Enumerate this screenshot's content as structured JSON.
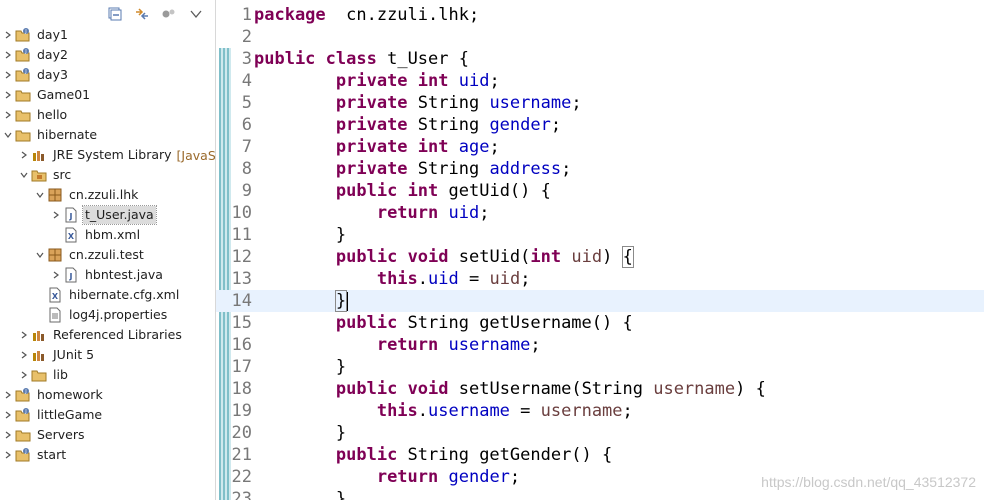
{
  "explorer": {
    "items": [
      {
        "label": "day1",
        "indent": 0,
        "expanded": false,
        "icon": "project-icon"
      },
      {
        "label": "day2",
        "indent": 0,
        "expanded": false,
        "icon": "project-icon"
      },
      {
        "label": "day3",
        "indent": 0,
        "expanded": false,
        "icon": "project-icon"
      },
      {
        "label": "Game01",
        "indent": 0,
        "expanded": false,
        "icon": "folder-icon"
      },
      {
        "label": "hello",
        "indent": 0,
        "expanded": false,
        "icon": "folder-icon"
      },
      {
        "label": "hibernate",
        "indent": 0,
        "expanded": true,
        "icon": "folder-icon"
      },
      {
        "label": "JRE System Library",
        "decoration": "[JavaSE-",
        "indent": 1,
        "expanded": false,
        "icon": "library-icon"
      },
      {
        "label": "src",
        "indent": 1,
        "expanded": true,
        "icon": "source-folder-icon"
      },
      {
        "label": "cn.zzuli.lhk",
        "indent": 2,
        "expanded": true,
        "icon": "package-icon"
      },
      {
        "label": "t_User.java",
        "indent": 3,
        "expanded": false,
        "icon": "java-file-icon",
        "selected": true
      },
      {
        "label": "hbm.xml",
        "indent": 3,
        "leaf": true,
        "icon": "xml-file-icon"
      },
      {
        "label": "cn.zzuli.test",
        "indent": 2,
        "expanded": true,
        "icon": "package-icon"
      },
      {
        "label": "hbntest.java",
        "indent": 3,
        "expanded": false,
        "icon": "java-file-icon"
      },
      {
        "label": "hibernate.cfg.xml",
        "indent": 2,
        "leaf": true,
        "icon": "xml-file-icon"
      },
      {
        "label": "log4j.properties",
        "indent": 2,
        "leaf": true,
        "icon": "properties-file-icon"
      },
      {
        "label": "Referenced Libraries",
        "indent": 1,
        "expanded": false,
        "icon": "library-icon"
      },
      {
        "label": "JUnit 5",
        "indent": 1,
        "expanded": false,
        "icon": "library-icon"
      },
      {
        "label": "lib",
        "indent": 1,
        "expanded": false,
        "icon": "folder-icon"
      },
      {
        "label": "homework",
        "indent": 0,
        "expanded": false,
        "icon": "project-icon"
      },
      {
        "label": "littleGame",
        "indent": 0,
        "expanded": false,
        "icon": "project-icon"
      },
      {
        "label": "Servers",
        "indent": 0,
        "expanded": false,
        "icon": "folder-icon"
      },
      {
        "label": "start",
        "indent": 0,
        "expanded": false,
        "icon": "project-icon"
      }
    ],
    "toolbar": [
      "collapse-all-icon",
      "link-with-editor-icon",
      "filters-icon",
      "view-menu-icon"
    ]
  },
  "editor": {
    "current_line": 14,
    "lines": [
      {
        "n": "1",
        "t": [
          [
            "kw",
            "package"
          ],
          [
            "",
            "  cn.zzuli.lhk;"
          ]
        ]
      },
      {
        "n": "2",
        "t": []
      },
      {
        "n": "3",
        "t": [
          [
            "kw",
            "public"
          ],
          [
            "",
            " "
          ],
          [
            "kw",
            "class"
          ],
          [
            "",
            " t_User {"
          ]
        ]
      },
      {
        "n": "4",
        "t": [
          [
            "",
            "        "
          ],
          [
            "kw",
            "private"
          ],
          [
            "",
            " "
          ],
          [
            "kw",
            "int"
          ],
          [
            "",
            " "
          ],
          [
            "fld",
            "uid"
          ],
          [
            "",
            ";"
          ]
        ]
      },
      {
        "n": "5",
        "t": [
          [
            "",
            "        "
          ],
          [
            "kw",
            "private"
          ],
          [
            "",
            " String "
          ],
          [
            "fld",
            "username"
          ],
          [
            "",
            ";"
          ]
        ]
      },
      {
        "n": "6",
        "t": [
          [
            "",
            "        "
          ],
          [
            "kw",
            "private"
          ],
          [
            "",
            " String "
          ],
          [
            "fld",
            "gender"
          ],
          [
            "",
            ";"
          ]
        ]
      },
      {
        "n": "7",
        "t": [
          [
            "",
            "        "
          ],
          [
            "kw",
            "private"
          ],
          [
            "",
            " "
          ],
          [
            "kw",
            "int"
          ],
          [
            "",
            " "
          ],
          [
            "fld",
            "age"
          ],
          [
            "",
            ";"
          ]
        ]
      },
      {
        "n": "8",
        "t": [
          [
            "",
            "        "
          ],
          [
            "kw",
            "private"
          ],
          [
            "",
            " String "
          ],
          [
            "fld",
            "address"
          ],
          [
            "",
            ";"
          ]
        ]
      },
      {
        "n": "9",
        "t": [
          [
            "",
            "        "
          ],
          [
            "kw",
            "public"
          ],
          [
            "",
            " "
          ],
          [
            "kw",
            "int"
          ],
          [
            "",
            " getUid() {"
          ]
        ]
      },
      {
        "n": "10",
        "t": [
          [
            "",
            "            "
          ],
          [
            "kw",
            "return"
          ],
          [
            "",
            " "
          ],
          [
            "fld",
            "uid"
          ],
          [
            "",
            ";"
          ]
        ]
      },
      {
        "n": "11",
        "t": [
          [
            "",
            "        }"
          ]
        ]
      },
      {
        "n": "12",
        "t": [
          [
            "",
            "        "
          ],
          [
            "kw",
            "public"
          ],
          [
            "",
            " "
          ],
          [
            "kw",
            "void"
          ],
          [
            "",
            " setUid("
          ],
          [
            "kw",
            "int"
          ],
          [
            "",
            " "
          ],
          [
            "par",
            "uid"
          ],
          [
            "",
            ") "
          ],
          [
            "box",
            "{"
          ]
        ]
      },
      {
        "n": "13",
        "t": [
          [
            "",
            "            "
          ],
          [
            "kw",
            "this"
          ],
          [
            "",
            "."
          ],
          [
            "fld",
            "uid"
          ],
          [
            "",
            " = "
          ],
          [
            "par",
            "uid"
          ],
          [
            "",
            ";"
          ]
        ]
      },
      {
        "n": "14",
        "t": [
          [
            "",
            "        "
          ],
          [
            "box",
            "}"
          ],
          [
            "caret",
            ""
          ]
        ]
      },
      {
        "n": "15",
        "t": [
          [
            "",
            "        "
          ],
          [
            "kw",
            "public"
          ],
          [
            "",
            " String getUsername() {"
          ]
        ]
      },
      {
        "n": "16",
        "t": [
          [
            "",
            "            "
          ],
          [
            "kw",
            "return"
          ],
          [
            "",
            " "
          ],
          [
            "fld",
            "username"
          ],
          [
            "",
            ";"
          ]
        ]
      },
      {
        "n": "17",
        "t": [
          [
            "",
            "        }"
          ]
        ]
      },
      {
        "n": "18",
        "t": [
          [
            "",
            "        "
          ],
          [
            "kw",
            "public"
          ],
          [
            "",
            " "
          ],
          [
            "kw",
            "void"
          ],
          [
            "",
            " setUsername(String "
          ],
          [
            "par",
            "username"
          ],
          [
            "",
            ") {"
          ]
        ]
      },
      {
        "n": "19",
        "t": [
          [
            "",
            "            "
          ],
          [
            "kw",
            "this"
          ],
          [
            "",
            "."
          ],
          [
            "fld",
            "username"
          ],
          [
            "",
            " = "
          ],
          [
            "par",
            "username"
          ],
          [
            "",
            ";"
          ]
        ]
      },
      {
        "n": "20",
        "t": [
          [
            "",
            "        }"
          ]
        ]
      },
      {
        "n": "21",
        "t": [
          [
            "",
            "        "
          ],
          [
            "kw",
            "public"
          ],
          [
            "",
            " String getGender() {"
          ]
        ]
      },
      {
        "n": "22",
        "t": [
          [
            "",
            "            "
          ],
          [
            "kw",
            "return"
          ],
          [
            "",
            " "
          ],
          [
            "fld",
            "gender"
          ],
          [
            "",
            ";"
          ]
        ]
      },
      {
        "n": "23",
        "t": [
          [
            "",
            "        }"
          ]
        ]
      }
    ]
  },
  "watermark": "https://blog.csdn.net/qq_43512372"
}
